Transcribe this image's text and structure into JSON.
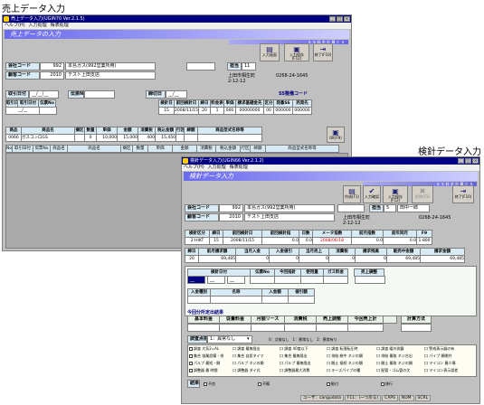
{
  "captions": {
    "sales": "売上データ入力",
    "meter": "検針データ入力"
  },
  "w1": {
    "title": "売上データ入力(UGIN70 Ver.2.1.5)",
    "menu": [
      "ヘルプ(H)",
      "入力処理",
      "帳表処理"
    ],
    "header": "売上データの入力",
    "strip": "Ｓ Ｓ 料 金 計 算 Ｃ Ｓ",
    "toolbar": [
      {
        "label": "入力画面",
        "icon": "clipboard-icon"
      },
      {
        "label": "入力保存(F12)",
        "icon": "save-icon"
      },
      {
        "label": "終了(F10)",
        "icon": "exit-icon"
      }
    ],
    "company_label": "会社コード",
    "company_code": "992",
    "company_name": "本島ガス(992営業所用)",
    "customer_label": "顧客コード",
    "customer_code": "2010",
    "customer_name": "テスト上田支店",
    "staff_label": "担当",
    "staff_code": "11",
    "addr_label": "上田市相生町",
    "addr_num": "2-12-12",
    "phone": "0268-24-1645",
    "trade_date_label": "取引日付",
    "trade_date": "__/__/__",
    "slip_label": "伝票No",
    "close_label": "締切日",
    "close_value": "__/__",
    "ss_label": "SS整備コード",
    "meter_heads": [
      "検針日",
      "前回検針日",
      "締日",
      "料金表",
      "単価",
      "請求基礎金先",
      "区分",
      "発番SS",
      "売発先"
    ],
    "meter_vals": [
      "15",
      "2008/11/15",
      "20",
      "1",
      "000",
      "00000000",
      "00",
      "000000",
      "000000"
    ],
    "sub_heads": [
      "取引日",
      "取引日付",
      "伝票No"
    ],
    "sub_vals": [
      "__/__",
      ""
    ],
    "item_heads": [
      "商品",
      "商品名",
      "摘区",
      "数量",
      "単価",
      "金額",
      "消費税",
      "税込金額",
      "行区",
      "締額",
      "商品型式名称等"
    ],
    "item_row": [
      "0066",
      "ガスコンロGS",
      "",
      "0",
      "10,000",
      "15,000",
      "400",
      "15,450",
      "",
      "",
      ""
    ],
    "ok_label": "OK(F9)",
    "col_heads": [
      "No",
      "取引日付",
      "伝票No",
      "商品名",
      "商品名",
      "摘区",
      "数量",
      "単価",
      "金額",
      "消費税",
      "税込金額",
      "行区",
      "締額",
      "商品型式名称等"
    ]
  },
  "w2": {
    "title": "検針データ入力(UGIN66 Ver.2.1.2)",
    "menu": [
      "ヘルプ(H)",
      "入力処理",
      "帳表処理"
    ],
    "header": "検針データ入力",
    "strip": "Ｓ Ｓ 料 金 計 算 Ｃ Ｓ",
    "toolbar": [
      {
        "label": "作成(F1)",
        "icon": "new-icon"
      },
      {
        "label": "入力確認",
        "icon": "check-icon"
      },
      {
        "label": "入力保存(F12)",
        "icon": "save-icon"
      },
      {
        "label": "削除(F3)",
        "icon": "delete-icon"
      },
      {
        "label": "終了(F10)",
        "icon": "exit-icon"
      }
    ],
    "company_label": "会社コード",
    "company_code": "992",
    "company_name": "本島ガス(992営業所用)",
    "customer_label": "顧客コード",
    "customer_code": "2010",
    "customer_name": "テスト上田支店",
    "staff_label": "担当",
    "staff_code": "5",
    "staff_name": "田中一郎",
    "addr_label": "上田市相生町",
    "addr_num": "2-12-12",
    "phone": "0268-24-1645",
    "r1_heads": [
      "検針区分",
      "締日",
      "前回検針日",
      "前回検針指",
      "日数",
      "メータ指数",
      "前月指数",
      "前年同月",
      "F9"
    ],
    "r1_vals": [
      "2:HIKT",
      "15",
      "2008/11/15",
      "0.0",
      "0.0",
      "2008/06/18",
      "0.0",
      "0.0",
      "1-800"
    ],
    "r2_heads": [
      "締日",
      "前月請求額",
      "当月入金",
      "入金値引",
      "当月売上",
      "消費税",
      "請求残高",
      "販売中金額",
      "請求金額"
    ],
    "r2_vals": [
      "20",
      "69,485",
      "0",
      "0",
      "0",
      "0",
      "0",
      "69,485",
      "69,485"
    ],
    "r3_heads": [
      "検針日付",
      "伝票No",
      "今回指針",
      "使用量",
      "ガス料金",
      "",
      "売上調整"
    ],
    "r3_date": [
      "__",
      "__",
      "__"
    ],
    "r4_heads": [
      "入金種別",
      "名称",
      "入金額",
      "値引額"
    ],
    "calc_title": "今回分所定出結果",
    "calc_heads": [
      "基本料金",
      "従量料金",
      "月額リース",
      "消費税",
      "売上調整",
      "今回売上計",
      "",
      "計算方法"
    ],
    "survey_label": "調査点検",
    "survey_sel": "1：異常なし",
    "survey_note": "0：点検なし　1：異常なし　2：異常有り",
    "checks": [
      [
        "調査 大気2=AL",
        "口 調査 最無限出",
        "口 調査 40度以下",
        "口 調査 転落転圧時",
        "口 調査 暖外測露",
        "口 警戒表示器の有"
      ],
      [
        "集合 協業設備・排",
        "口 集合 自設タイマ",
        "口 集合 最無限出",
        "口 排給 総中 ネジの類",
        "口 排給 最取 ネジ台出",
        "口 パイプ 開閉弁"
      ],
      [
        "パルプ 最短・開",
        "口 パルプ ネジの類",
        "口 パルプ 最無限出",
        "口 開止 接続 ネジの類",
        "口 開止 最取 ネジの類",
        "口 マイコン 最少場"
      ],
      [
        "調整器 最 時間",
        "口 調整器 ダイ式",
        "口 調整器最大消費",
        "口 キーズパイプの種",
        "口 配管・ゴム管の欠",
        "口 マイコン表示誤差"
      ]
    ],
    "result_label": "結果",
    "result_opts": [
      "不良",
      "不備",
      "勧付",
      "移行"
    ],
    "status": [
      "ユーザ：cangudata",
      "F11：(一つ戻る)",
      "CAPS",
      "NUM",
      "SCRL"
    ]
  }
}
